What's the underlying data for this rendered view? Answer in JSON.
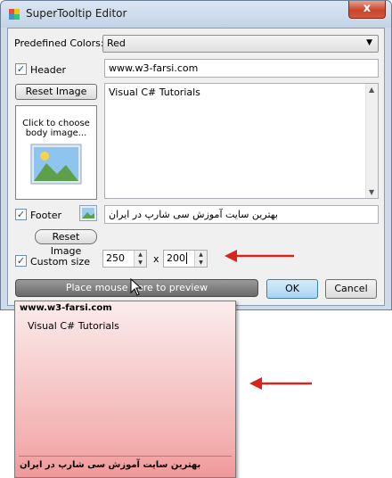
{
  "window": {
    "title": "SuperTooltip Editor",
    "close_glyph": "x"
  },
  "colors": {
    "label": "Predefined Colors:",
    "value": "Red"
  },
  "header": {
    "checked": true,
    "label": "Header",
    "value": "www.w3-farsi.com"
  },
  "body": {
    "reset_image": "Reset Image",
    "image_hint": "Click to choose body image...",
    "text": "Visual C# Tutorials"
  },
  "footer": {
    "checked": true,
    "label": "Footer",
    "value": "بهترین سایت آموزش سی شارپ در ایران",
    "reset_image": "Reset Image"
  },
  "custom_size": {
    "checked": true,
    "label": "Custom size",
    "width": "250",
    "separator": "x",
    "height": "200"
  },
  "actions": {
    "preview": "Place mouse here to preview",
    "ok": "OK",
    "cancel": "Cancel"
  },
  "tooltip_preview": {
    "header": "www.w3-farsi.com",
    "body": "Visual C# Tutorials",
    "footer": "بهترین سایت آموزش سی شارپ در ایران"
  },
  "theme": {
    "tooltip_color": "#f3b0b0",
    "arrow_color": "#d9231d"
  }
}
